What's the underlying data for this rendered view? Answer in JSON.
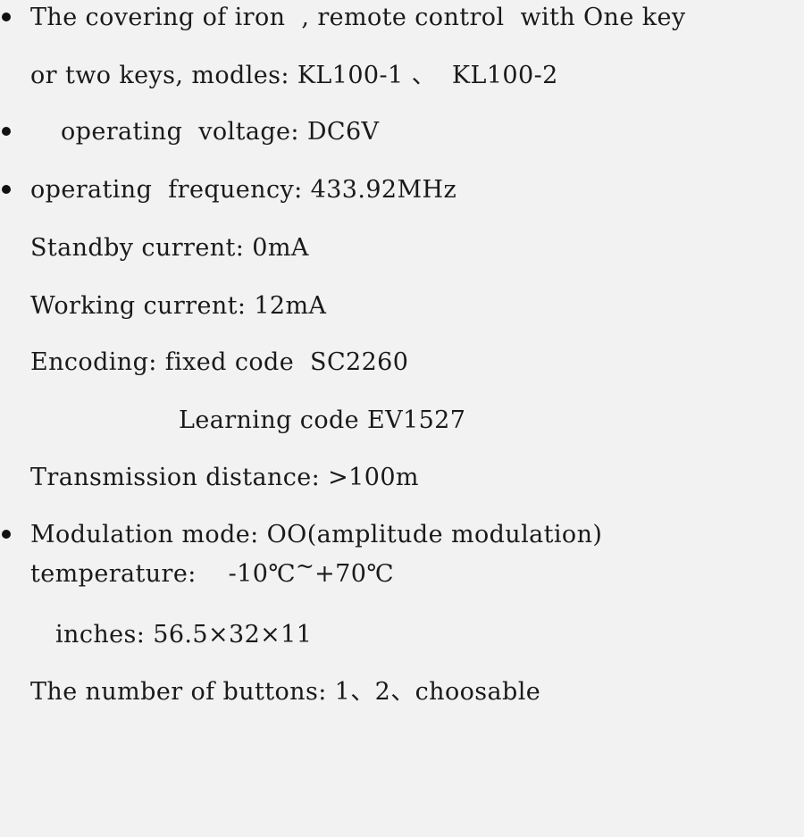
{
  "document": {
    "type": "product-specification-list",
    "background_color": "#f2f2f2",
    "text_color": "#1a1a1a",
    "lines": [
      {
        "id": "covering-of-iron",
        "bullet": true,
        "text": "The covering of iron  , remote control  with One key"
      },
      {
        "id": "models",
        "bullet": false,
        "text": "or two keys, modles: KL100-1 、  KL100-2"
      },
      {
        "id": "operating-voltage",
        "bullet": true,
        "text": "operating  voltage: DC6V"
      },
      {
        "id": "operating-frequency",
        "bullet": true,
        "text": "operating  frequency: 433.92MHz"
      },
      {
        "id": "standby-current",
        "bullet": false,
        "text": "Standby current: 0mA"
      },
      {
        "id": "working-current",
        "bullet": false,
        "text": "Working current: 12mA"
      },
      {
        "id": "encoding-fixed",
        "bullet": false,
        "text": "Encoding: fixed code  SC2260"
      },
      {
        "id": "encoding-learning",
        "bullet": false,
        "text": "Learning code EV1527"
      },
      {
        "id": "transmission-distance",
        "bullet": false,
        "text": "Transmission distance: >100m"
      },
      {
        "id": "modulation-mode",
        "bullet": true,
        "text": "Modulation mode: OO(amplitude modulation)"
      },
      {
        "id": "temperature",
        "bullet": false,
        "text_before": "temperature:    -10℃",
        "text_tilde": "~",
        "text_after": "+70℃"
      },
      {
        "id": "inches",
        "bullet": false,
        "text": "inches: 56.5×32×11"
      },
      {
        "id": "number-of-buttons",
        "bullet": false,
        "text": "The number of buttons: 1、2、choosable"
      }
    ]
  }
}
